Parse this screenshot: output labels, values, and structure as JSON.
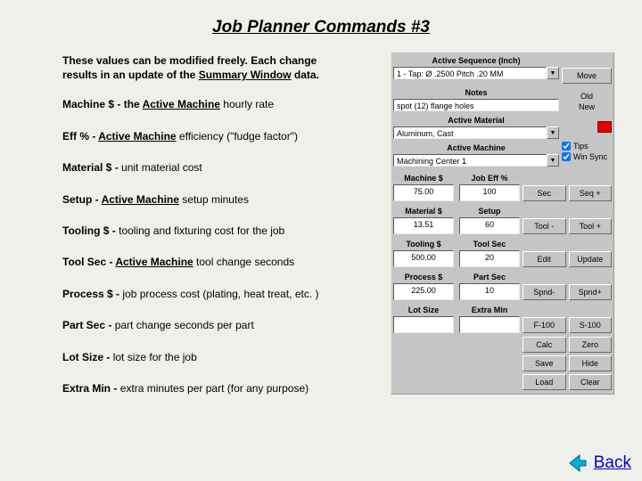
{
  "title": "Job Planner Commands #3",
  "intro_line1": "These values can be modified freely.  Each change",
  "intro_line2a": "results in an update of the ",
  "intro_line2b": "Summary Window",
  "intro_line2c": " data.",
  "defs": [
    {
      "term": "Machine $",
      "mid": " - the ",
      "uw": "Active Machine",
      "rest": " hourly rate"
    },
    {
      "term": "Eff %",
      "mid": " - ",
      "uw": "Active Machine",
      "rest": " efficiency (\"fudge factor\")"
    },
    {
      "term": "Material $",
      "mid": " - ",
      "uw": "",
      "rest": "unit material cost"
    },
    {
      "term": "Setup",
      "mid": " - ",
      "uw": "Active Machine",
      "rest": " setup minutes"
    },
    {
      "term": "Tooling $",
      "mid": " - ",
      "uw": "",
      "rest": "tooling and fixturing cost for the job"
    },
    {
      "term": "Tool Sec",
      "mid": " - ",
      "uw": "Active Machine",
      "rest": " tool change seconds"
    },
    {
      "term": "Process $",
      "mid": " - ",
      "uw": "",
      "rest": "job process cost (plating, heat treat, etc. )"
    },
    {
      "term": "Part Sec",
      "mid": " - ",
      "uw": "",
      "rest": "part change seconds per part"
    },
    {
      "term": "Lot Size",
      "mid": " - ",
      "uw": "",
      "rest": "lot size for the job"
    },
    {
      "term": "Extra Min",
      "mid": " - ",
      "uw": "",
      "rest": "extra minutes per part (for any purpose)"
    }
  ],
  "panel": {
    "active_sequence_label": "Active Sequence (Inch)",
    "active_sequence_value": "1 - Tap:  Ø .2500    Pitch .20 MM",
    "move_btn": "Move",
    "notes_label": "Notes",
    "notes_value": "spot (12) flange holes",
    "old_label": "Old",
    "new_label": "New",
    "active_material_label": "Active Material",
    "active_material_value": "Aluminum, Cast",
    "active_machine_label": "Active Machine",
    "active_machine_value": "Machining Center 1",
    "tips_label": "Tips",
    "winsync_label": "Win Sync",
    "fields": [
      {
        "l": "Machine $",
        "v": "75.00"
      },
      {
        "l": "Job Eff %",
        "v": "100"
      },
      {
        "l": "Material $",
        "v": "13.51"
      },
      {
        "l": "Setup",
        "v": "60"
      },
      {
        "l": "Tooling $",
        "v": "500.00"
      },
      {
        "l": "Tool Sec",
        "v": "20"
      },
      {
        "l": "Process $",
        "v": "225.00"
      },
      {
        "l": "Part Sec",
        "v": "10"
      },
      {
        "l": "Lot Size",
        "v": ""
      },
      {
        "l": "Extra Min",
        "v": ""
      }
    ],
    "buttons": [
      "Sec",
      "Seq +",
      "Tool -",
      "Tool +",
      "Edit",
      "Update",
      "Spnd-",
      "Spnd+",
      "F-100",
      "S-100",
      "Calc",
      "Zero",
      "Save",
      "Hide",
      "Load",
      "Clear"
    ]
  },
  "back_label": "Back"
}
